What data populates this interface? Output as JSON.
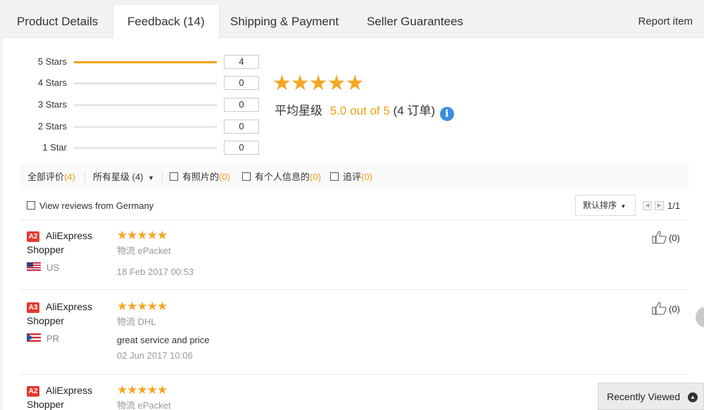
{
  "tabs": [
    {
      "label": "Product Details"
    },
    {
      "label": "Feedback (14)"
    },
    {
      "label": "Shipping & Payment"
    },
    {
      "label": "Seller Guarantees"
    }
  ],
  "report_item": "Report item",
  "histogram": [
    {
      "label": "5 Stars",
      "count": "4",
      "fraction": 1.0
    },
    {
      "label": "4 Stars",
      "count": "0",
      "fraction": 0
    },
    {
      "label": "3 Stars",
      "count": "0",
      "fraction": 0
    },
    {
      "label": "2 Stars",
      "count": "0",
      "fraction": 0
    },
    {
      "label": "1 Star",
      "count": "0",
      "fraction": 0
    }
  ],
  "summary": {
    "stars": "★★★★★",
    "avg_label": "平均星级",
    "avg_score": "5.0 out of 5",
    "orders": "(4 订单)",
    "info_icon": "i"
  },
  "filters": {
    "all_label": "全部评价",
    "all_count": "(4)",
    "star_select": "所有星级 (4)",
    "photos_label": "有照片的",
    "photos_count": "(0)",
    "personal_label": "有个人信息的",
    "personal_count": "(0)",
    "followup_label": "追评",
    "followup_count": "(0)"
  },
  "view_germany": "View reviews from Germany",
  "sort": {
    "selected": "默认排序"
  },
  "pager": {
    "page": "1/1"
  },
  "reviews": [
    {
      "badge": "A2",
      "name": "AliExpress Shopper",
      "country": "US",
      "stars": "★★★★★",
      "logistics": "物流 ePacket",
      "text": "",
      "date": "18 Feb 2017 00:53",
      "likes": "(0)"
    },
    {
      "badge": "A3",
      "name": "AliExpress Shopper",
      "country": "PR",
      "stars": "★★★★★",
      "logistics": "物流 DHL",
      "text": "great service and price",
      "date": "02 Jun 2017 10:06",
      "likes": "(0)"
    },
    {
      "badge": "A2",
      "name": "AliExpress Shopper",
      "country": "",
      "stars": "★★★★★",
      "logistics": "物流 ePacket",
      "text": "",
      "date": "",
      "likes": ""
    }
  ],
  "recently_viewed": "Recently Viewed",
  "colors": {
    "accent": "#f1a014",
    "badge": "#e33a2f",
    "info": "#3c8de0"
  }
}
